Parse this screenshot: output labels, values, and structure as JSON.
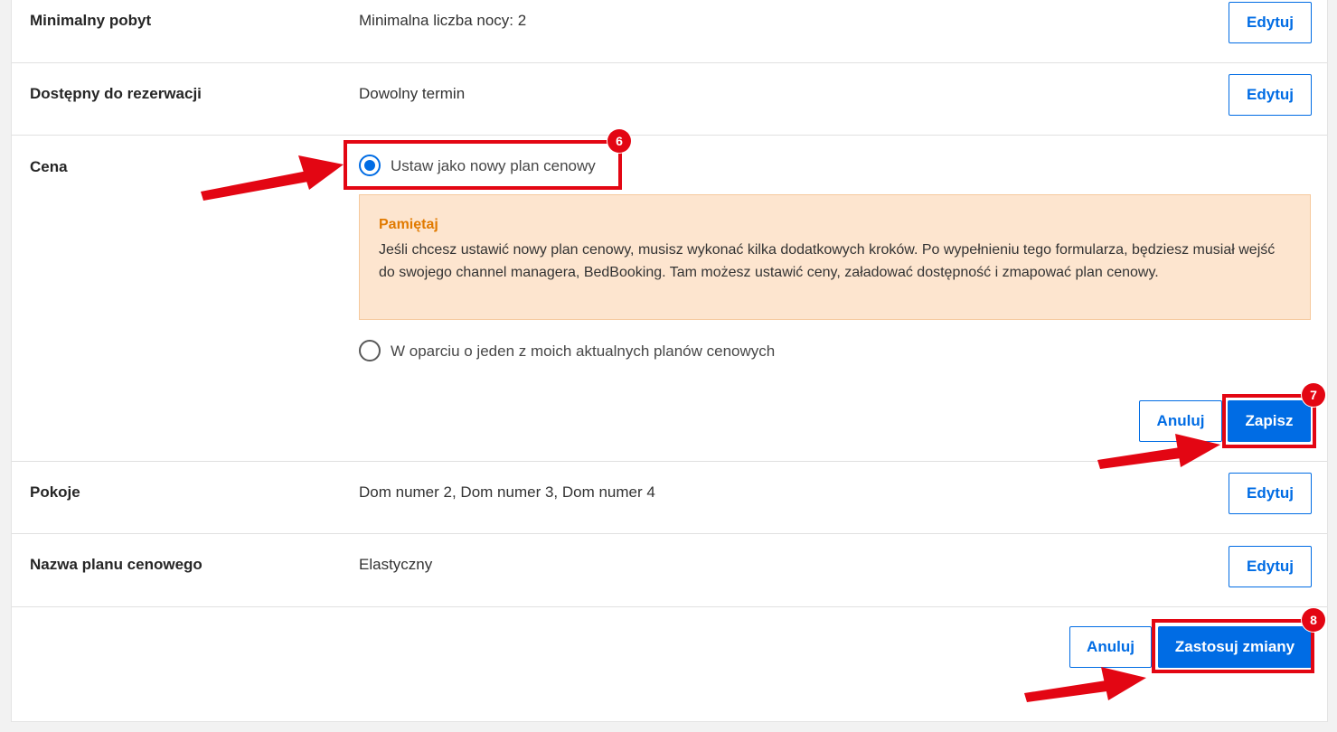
{
  "rows": {
    "min_stay": {
      "label": "Minimalny pobyt",
      "value": "Minimalna liczba nocy: 2",
      "button": "Edytuj"
    },
    "available": {
      "label": "Dostępny do rezerwacji",
      "value": "Dowolny termin",
      "button": "Edytuj"
    },
    "price": {
      "label": "Cena",
      "option_new": "Ustaw jako nowy plan cenowy",
      "option_existing": "W oparciu o jeden z moich aktualnych planów cenowych",
      "notice_title": "Pamiętaj",
      "notice_text": "Jeśli chcesz ustawić nowy plan cenowy, musisz wykonać kilka dodatkowych kroków. Po wypełnieniu tego formularza, będziesz musiał wejść do swojego channel managera, BedBooking. Tam możesz ustawić ceny, załadować dostępność i zmapować plan cenowy.",
      "cancel": "Anuluj",
      "save": "Zapisz"
    },
    "rooms": {
      "label": "Pokoje",
      "value": "Dom numer 2, Dom numer 3, Dom numer 4",
      "button": "Edytuj"
    },
    "plan_name": {
      "label": "Nazwa planu cenowego",
      "value": "Elastyczny",
      "button": "Edytuj"
    }
  },
  "footer": {
    "cancel": "Anuluj",
    "apply": "Zastosuj zmiany"
  },
  "annotations": {
    "step6": "6",
    "step7": "7",
    "step8": "8"
  },
  "colors": {
    "accent": "#006ce4",
    "highlight": "#e30613",
    "notice_bg": "#fde5cf",
    "notice_title": "#e17a00"
  }
}
